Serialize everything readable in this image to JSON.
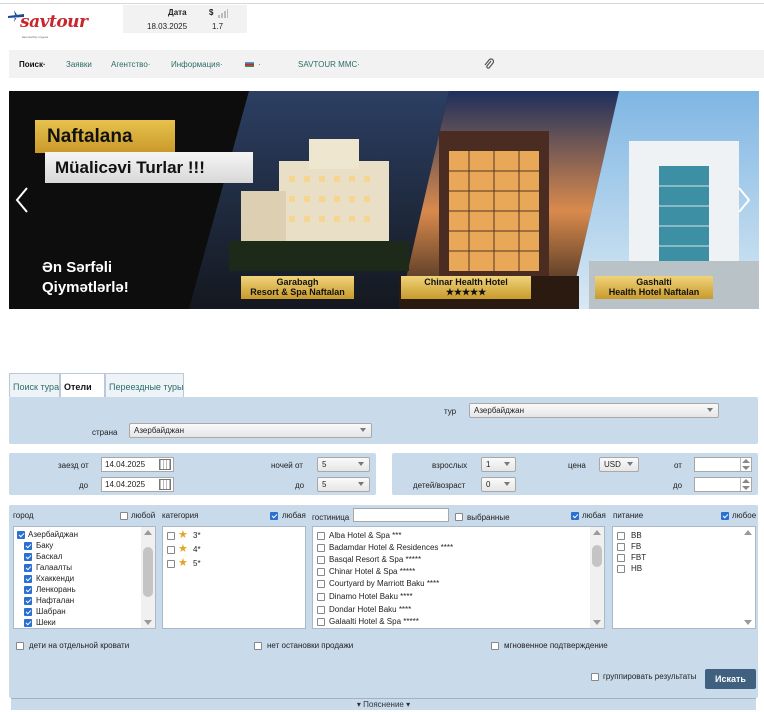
{
  "header": {
    "logo_text": "savtour",
    "logo_tagline": "ваш выбор отдыха",
    "rate": {
      "date_label": "Дата",
      "currency_label": "$",
      "date_value": "18.03.2025",
      "rate_value": "1.7"
    }
  },
  "nav": {
    "items": [
      {
        "label": "Поиск",
        "active": true
      },
      {
        "label": "Заявки"
      },
      {
        "label": "Агентство"
      },
      {
        "label": "Информация"
      },
      {
        "label": ""
      },
      {
        "label": "SAVTOUR MMC"
      }
    ],
    "dropdown_marker": "·"
  },
  "banner": {
    "title_line1": "Naftalana",
    "title_line2": "Müalicəvi Turlar !!!",
    "slogan_line1": "Ən Sərfəli",
    "slogan_line2": "Qiymətlərlə!",
    "hotel1": [
      "Garabagh",
      "Resort & Spa Naftalan"
    ],
    "hotel2": [
      "Chinar Health Hotel",
      "★★★★★"
    ],
    "hotel3": [
      "Gashalti",
      "Health Hotel Naftalan"
    ]
  },
  "tabs": [
    {
      "label": "Поиск тура"
    },
    {
      "label": "Отели",
      "active": true
    },
    {
      "label": "Переездные туры"
    }
  ],
  "form": {
    "tour_label": "тур",
    "tour_value": "Азербайджан",
    "country_label": "страна",
    "country_value": "Азербайджан",
    "checkin_label": "заезд от",
    "checkin_value": "14.04.2025",
    "checkout_label": "до",
    "checkout_value": "14.04.2025",
    "nights_from_label": "ночей от",
    "nights_from_value": "5",
    "nights_to_label": "до",
    "nights_to_value": "5",
    "adults_label": "взрослых",
    "adults_value": "1",
    "children_label": "детей/возраст",
    "children_value": "0",
    "price_label": "цена",
    "currency_value": "USD",
    "price_from_label": "от",
    "price_to_label": "до"
  },
  "filters": {
    "city": {
      "label": "город",
      "any_label": "любой",
      "items": [
        {
          "label": "Азербайджан",
          "checked": true
        },
        {
          "label": "Баку",
          "checked": true
        },
        {
          "label": "Баскал",
          "checked": true
        },
        {
          "label": "Галаалты",
          "checked": true
        },
        {
          "label": "Кхаккенди",
          "checked": true
        },
        {
          "label": "Ленкорань",
          "checked": true
        },
        {
          "label": "Нафталан",
          "checked": true
        },
        {
          "label": "Шабран",
          "checked": true
        },
        {
          "label": "Шеки",
          "checked": true
        }
      ]
    },
    "category": {
      "label": "категория",
      "any_label": "любая",
      "items": [
        {
          "label": "3*"
        },
        {
          "label": "4*"
        },
        {
          "label": "5*"
        }
      ]
    },
    "hotel": {
      "label": "гостиница",
      "selected_label": "выбранные",
      "any_label": "любая",
      "items": [
        {
          "label": "Alba Hotel & Spa ***"
        },
        {
          "label": "Badamdar Hotel & Residences ****"
        },
        {
          "label": "Basqal Resort & Spa *****"
        },
        {
          "label": "Chinar Hotel & Spa *****"
        },
        {
          "label": "Courtyard by Marriott Baku ****"
        },
        {
          "label": "Dinamo Hotel Baku ****"
        },
        {
          "label": "Dondar Hotel Baku ****"
        },
        {
          "label": "Galaalti Hotel & Spa *****"
        }
      ]
    },
    "meal": {
      "label": "питание",
      "any_label": "любое",
      "items": [
        {
          "label": "BB"
        },
        {
          "label": "FB"
        },
        {
          "label": "FBT"
        },
        {
          "label": "HB"
        }
      ]
    }
  },
  "options": {
    "separate_bed": "дети на отдельной кровати",
    "no_stop_sale": "нет остановки продажи",
    "instant_confirm": "мгновенное подтверждение",
    "group_results": "группировать результаты"
  },
  "search_button": "Искать",
  "explain_label": "▾ Пояснение ▾",
  "colors": {
    "panel_bg": "#c9daeb",
    "search_button_bg": "#3f607e",
    "nav_link": "#2c6e67",
    "brand_red": "#c8262c"
  }
}
